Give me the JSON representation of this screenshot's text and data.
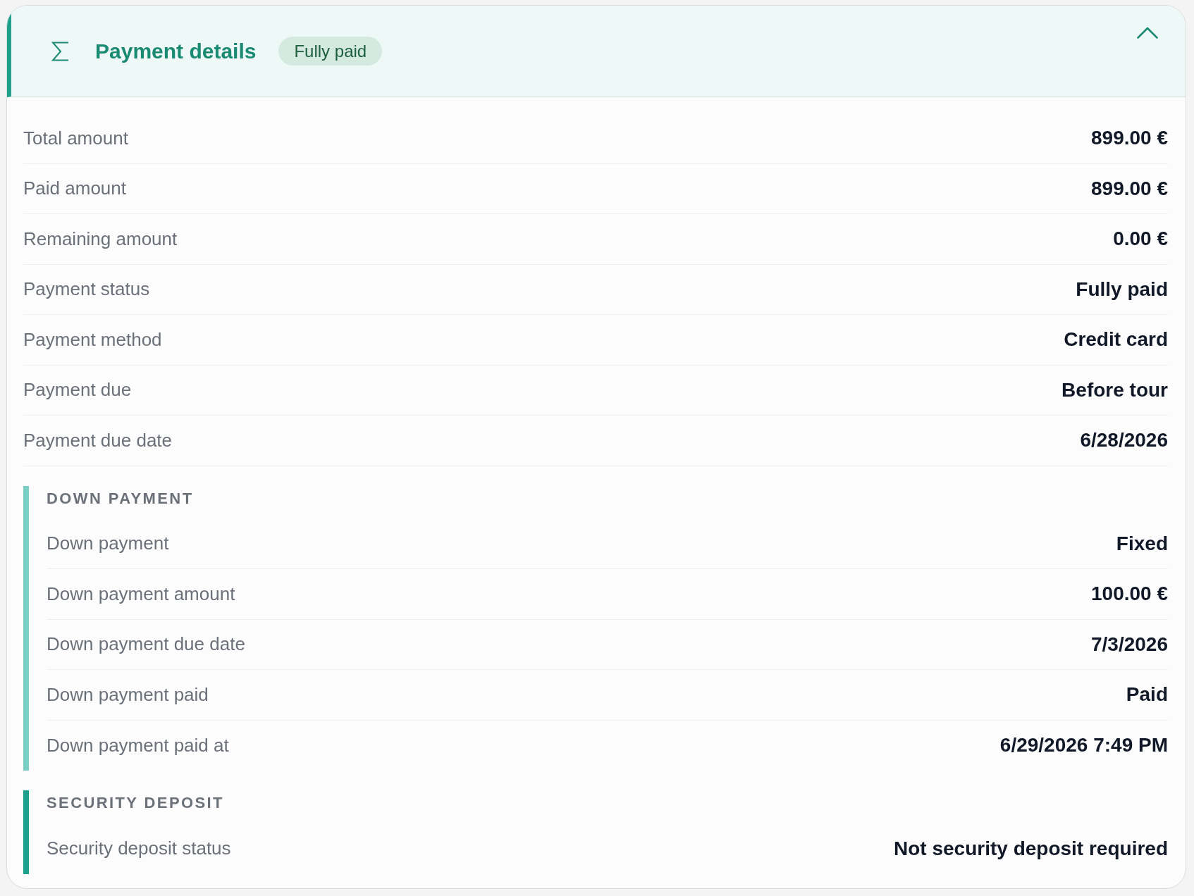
{
  "panel": {
    "title": "Payment details",
    "badge": "Fully paid",
    "expanded": true
  },
  "rows": [
    {
      "label": "Total amount",
      "value": "899.00 €"
    },
    {
      "label": "Paid amount",
      "value": "899.00 €"
    },
    {
      "label": "Remaining amount",
      "value": "0.00 €"
    },
    {
      "label": "Payment status",
      "value": "Fully paid"
    },
    {
      "label": "Payment method",
      "value": "Credit card"
    },
    {
      "label": "Payment due",
      "value": "Before tour"
    },
    {
      "label": "Payment due date",
      "value": "6/28/2026"
    }
  ],
  "sections": [
    {
      "heading": "DOWN PAYMENT",
      "color": "#77d0c3",
      "rows": [
        {
          "label": "Down payment",
          "value": "Fixed"
        },
        {
          "label": "Down payment amount",
          "value": "100.00 €"
        },
        {
          "label": "Down payment due date",
          "value": "7/3/2026"
        },
        {
          "label": "Down payment paid",
          "value": "Paid"
        },
        {
          "label": "Down payment paid at",
          "value": "6/29/2026 7:49 PM"
        }
      ]
    },
    {
      "heading": "SECURITY DEPOSIT",
      "color": "#1e9e8c",
      "rows": [
        {
          "label": "Security deposit status",
          "value": "Not security deposit required"
        }
      ]
    }
  ]
}
